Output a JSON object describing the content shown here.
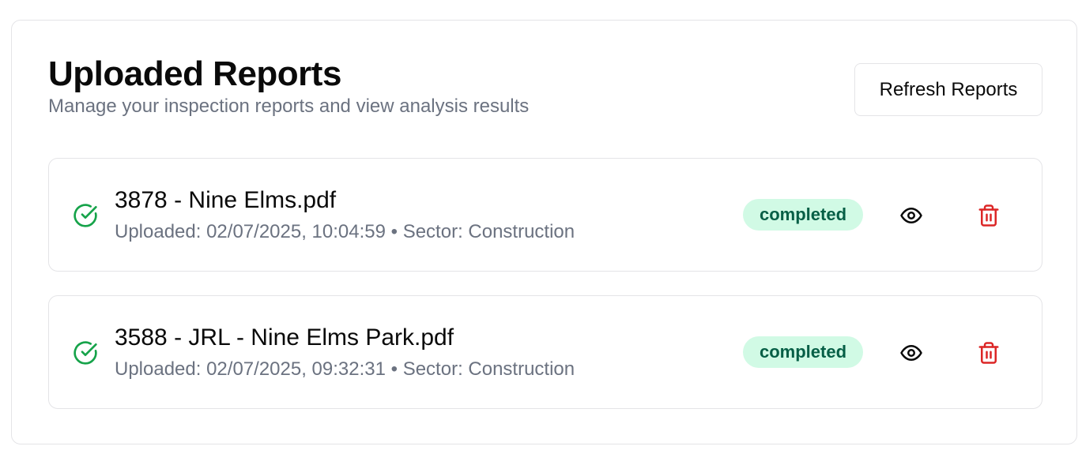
{
  "header": {
    "title": "Uploaded Reports",
    "subtitle": "Manage your inspection reports and view analysis results",
    "refresh_label": "Refresh Reports"
  },
  "reports": [
    {
      "file_name": "3878 - Nine Elms.pdf",
      "meta": "Uploaded: 02/07/2025, 10:04:59 • Sector: Construction",
      "status": "completed",
      "status_icon": "check-circle-icon",
      "actions": [
        "eye-icon",
        "trash-icon"
      ]
    },
    {
      "file_name": "3588 - JRL - Nine Elms Park.pdf",
      "meta": "Uploaded: 02/07/2025, 09:32:31 • Sector: Construction",
      "status": "completed",
      "status_icon": "check-circle-icon",
      "actions": [
        "eye-icon",
        "trash-icon"
      ]
    }
  ],
  "colors": {
    "success": "#16a34a",
    "badge_bg": "#d1fae5",
    "badge_text": "#065f46",
    "danger": "#dc2626",
    "muted_text": "#6b7280",
    "border": "#e4e4e7"
  }
}
